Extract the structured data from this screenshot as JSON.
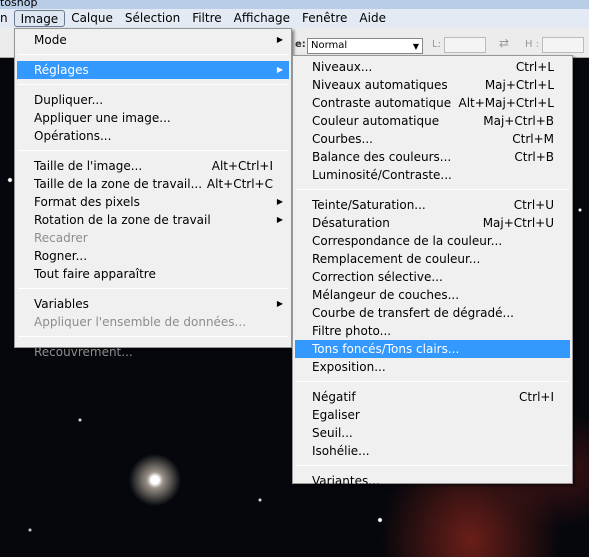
{
  "window": {
    "title": "toshop"
  },
  "menubar": [
    "n",
    "Image",
    "Calque",
    "Sélection",
    "Filtre",
    "Affichage",
    "Fenêtre",
    "Aide"
  ],
  "toolbar": {
    "mode_value": "Normal",
    "l_label": "L:",
    "h_label": "H :",
    "prefix": "e:"
  },
  "image_menu": [
    {
      "label": "Mode",
      "submenu": true
    },
    {
      "sep": true
    },
    {
      "label": "Réglages",
      "submenu": true,
      "highlighted": true
    },
    {
      "sep": true
    },
    {
      "label": "Dupliquer..."
    },
    {
      "label": "Appliquer une image..."
    },
    {
      "label": "Opérations..."
    },
    {
      "sep": true
    },
    {
      "label": "Taille de l'image...",
      "shortcut": "Alt+Ctrl+I"
    },
    {
      "label": "Taille de la zone de travail...",
      "shortcut": "Alt+Ctrl+C"
    },
    {
      "label": "Format des pixels",
      "submenu": true
    },
    {
      "label": "Rotation de la zone de travail",
      "submenu": true
    },
    {
      "label": "Recadrer",
      "disabled": true
    },
    {
      "label": "Rogner..."
    },
    {
      "label": "Tout faire apparaître"
    },
    {
      "sep": true
    },
    {
      "label": "Variables",
      "submenu": true
    },
    {
      "label": "Appliquer l'ensemble de données...",
      "disabled": true
    },
    {
      "sep": true
    },
    {
      "label": "Recouvrement...",
      "disabled": true
    }
  ],
  "reglages_menu": [
    {
      "label": "Niveaux...",
      "shortcut": "Ctrl+L"
    },
    {
      "label": "Niveaux automatiques",
      "shortcut": "Maj+Ctrl+L"
    },
    {
      "label": "Contraste automatique",
      "shortcut": "Alt+Maj+Ctrl+L"
    },
    {
      "label": "Couleur automatique",
      "shortcut": "Maj+Ctrl+B"
    },
    {
      "label": "Courbes...",
      "shortcut": "Ctrl+M"
    },
    {
      "label": "Balance des couleurs...",
      "shortcut": "Ctrl+B"
    },
    {
      "label": "Luminosité/Contraste..."
    },
    {
      "sep": true
    },
    {
      "label": "Teinte/Saturation...",
      "shortcut": "Ctrl+U"
    },
    {
      "label": "Désaturation",
      "shortcut": "Maj+Ctrl+U"
    },
    {
      "label": "Correspondance de la couleur..."
    },
    {
      "label": "Remplacement de couleur..."
    },
    {
      "label": "Correction sélective..."
    },
    {
      "label": "Mélangeur de couches..."
    },
    {
      "label": "Courbe de transfert de dégradé..."
    },
    {
      "label": "Filtre photo..."
    },
    {
      "label": "Tons foncés/Tons clairs...",
      "highlighted": true
    },
    {
      "label": "Exposition..."
    },
    {
      "sep": true
    },
    {
      "label": "Négatif",
      "shortcut": "Ctrl+I"
    },
    {
      "label": "Egaliser"
    },
    {
      "label": "Seuil..."
    },
    {
      "label": "Isohélie..."
    },
    {
      "sep": true
    },
    {
      "label": "Variantes..."
    }
  ],
  "colors": {
    "highlight": "#3399ff",
    "menu_bg": "#f0f0f0",
    "disabled": "#8d8d8d"
  }
}
